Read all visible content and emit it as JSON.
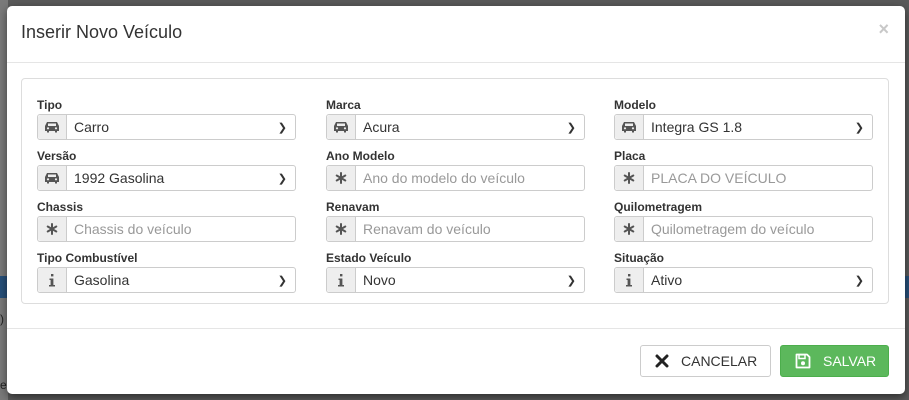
{
  "modal": {
    "title": "Inserir Novo Veículo",
    "close_glyph": "×"
  },
  "fields": {
    "tipo": {
      "label": "Tipo",
      "value": "Carro",
      "icon": "car-icon"
    },
    "marca": {
      "label": "Marca",
      "value": "Acura",
      "icon": "car-icon"
    },
    "modelo": {
      "label": "Modelo",
      "value": "Integra GS 1.8",
      "icon": "car-icon"
    },
    "versao": {
      "label": "Versão",
      "value": "1992 Gasolina",
      "icon": "car-icon"
    },
    "ano_modelo": {
      "label": "Ano Modelo",
      "placeholder": "Ano do modelo do veículo",
      "icon": "asterisk-icon"
    },
    "placa": {
      "label": "Placa",
      "placeholder": "PLACA DO VEÍCULO",
      "icon": "asterisk-icon"
    },
    "chassis": {
      "label": "Chassis",
      "placeholder": "Chassis do veículo",
      "icon": "asterisk-icon"
    },
    "renavam": {
      "label": "Renavam",
      "placeholder": "Renavam do veículo",
      "icon": "asterisk-icon"
    },
    "quilometragem": {
      "label": "Quilometragem",
      "placeholder": "Quilometragem do veículo",
      "icon": "asterisk-icon"
    },
    "tipo_combustivel": {
      "label": "Tipo Combustível",
      "value": "Gasolina",
      "icon": "info-icon"
    },
    "estado_veiculo": {
      "label": "Estado Veículo",
      "value": "Novo",
      "icon": "info-icon"
    },
    "situacao": {
      "label": "Situação",
      "value": "Ativo",
      "icon": "info-icon"
    }
  },
  "footer": {
    "cancel_label": "CANCELAR",
    "save_label": "SALVAR"
  },
  "background": {
    "text1": ")",
    "text2": "e"
  },
  "colors": {
    "save_green": "#5cb85c",
    "background_blue": "#27507a"
  }
}
